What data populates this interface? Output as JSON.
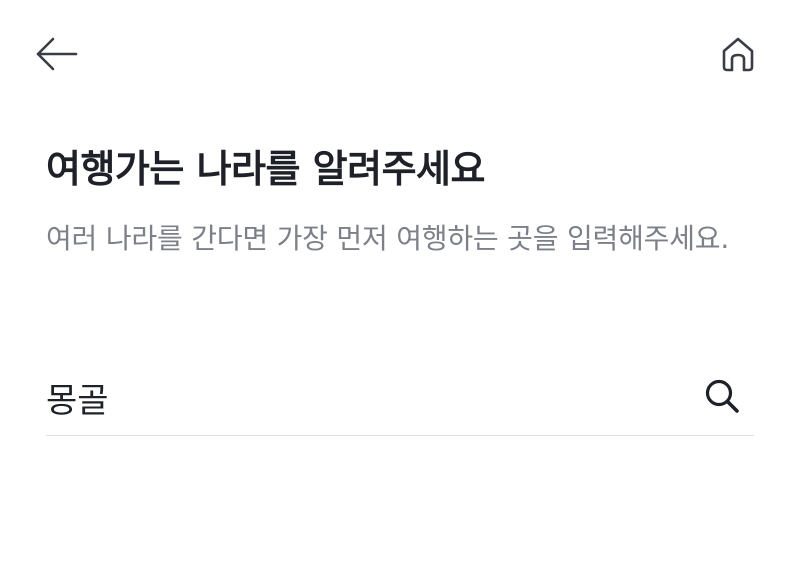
{
  "header": {
    "back_icon": "arrow-left-icon",
    "home_icon": "home-icon"
  },
  "main": {
    "title": "여행가는 나라를 알려주세요",
    "subtitle": "여러 나라를 간다면 가장 먼저 여행하는 곳을 입력해주세요."
  },
  "search": {
    "value": "몽골",
    "icon": "search-icon"
  },
  "colors": {
    "text_primary": "#1f2128",
    "text_secondary": "#7d8089",
    "divider": "#dcdde1",
    "background": "#ffffff"
  }
}
